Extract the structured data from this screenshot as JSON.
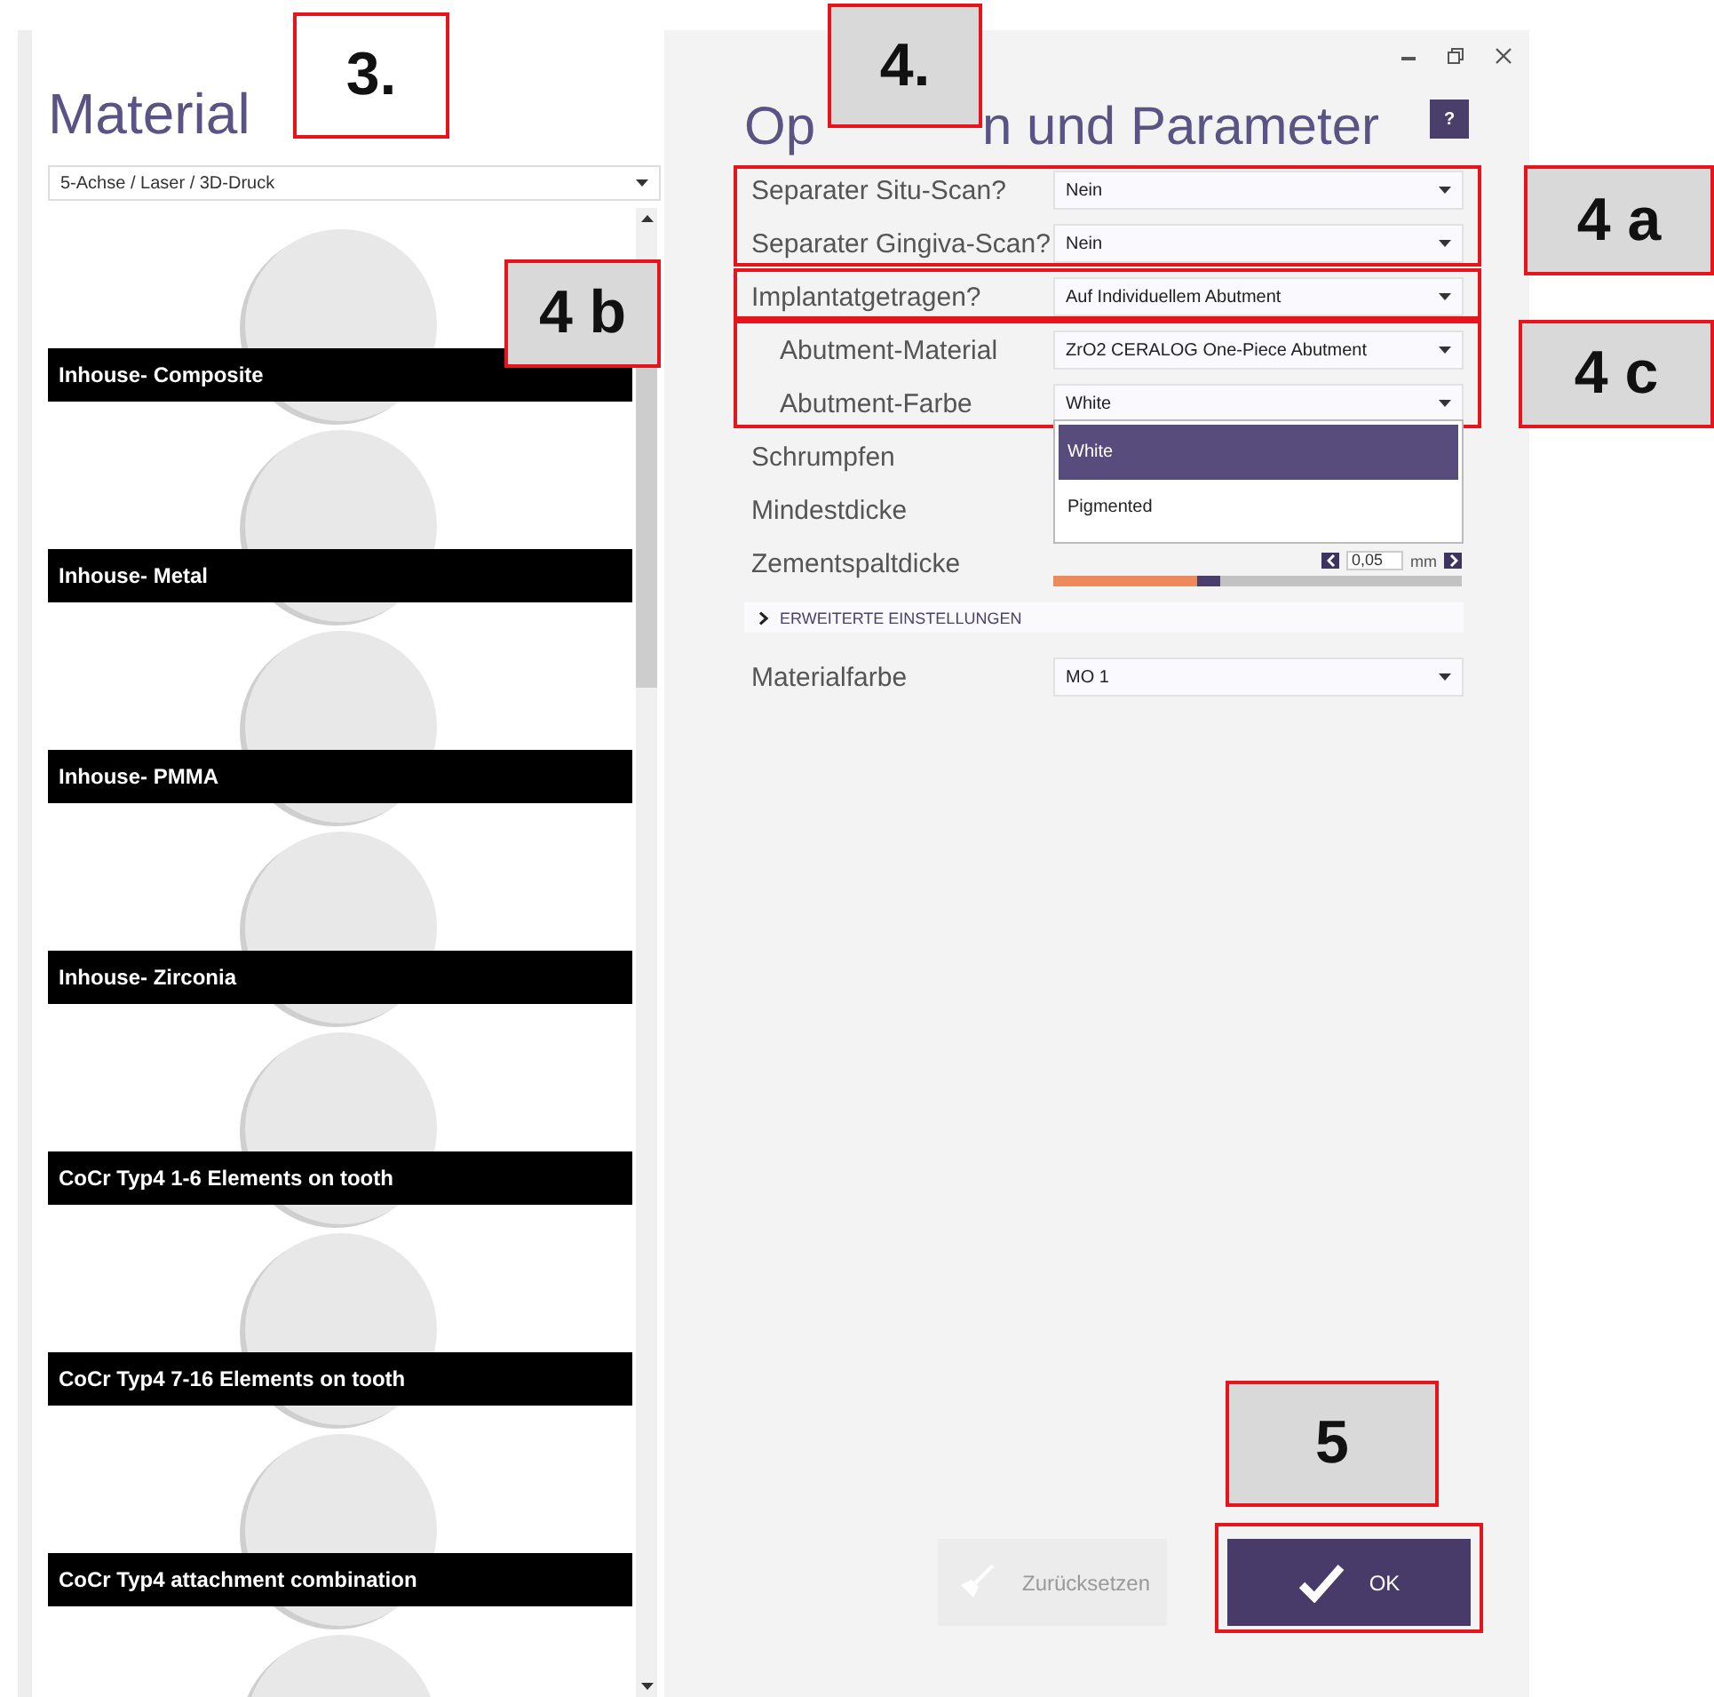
{
  "material_panel": {
    "title": "Material",
    "filter": "5-Achse / Laser / 3D-Druck",
    "materials": [
      {
        "name": "Inhouse- Composite"
      },
      {
        "name": "Inhouse- Metal"
      },
      {
        "name": "Inhouse- PMMA"
      },
      {
        "name": "Inhouse- Zirconia"
      },
      {
        "name": "CoCr Typ4 1-6 Elements on tooth"
      },
      {
        "name": "CoCr Typ4 7-16 Elements on tooth"
      },
      {
        "name": "CoCr Typ4 attachment combination"
      }
    ]
  },
  "options_panel": {
    "title_parts": [
      "Op",
      "n und Parameter"
    ],
    "help": "?",
    "fields": [
      {
        "label": "Separater Situ-Scan?",
        "value": "Nein",
        "indented": false
      },
      {
        "label": "Separater Gingiva-Scan?",
        "value": "Nein",
        "indented": false
      },
      {
        "label": "Implantatgetragen?",
        "value": "Auf Individuellem Abutment",
        "indented": false
      },
      {
        "label": "Abutment-Material",
        "value": "ZrO2 CERALOG One-Piece Abutment",
        "indented": true
      },
      {
        "label": "Abutment-Farbe",
        "value": "White",
        "indented": true
      }
    ],
    "open_dropdown": [
      {
        "label": "White",
        "selected": true
      },
      {
        "label": "Pigmented",
        "selected": false
      }
    ],
    "params": [
      {
        "label": "Schrumpfen"
      },
      {
        "label": "Mindestdicke"
      }
    ],
    "cement_gap": {
      "label": "Zementspaltdicke",
      "value": "0,05",
      "unit": "mm",
      "level": 0.35
    },
    "advanced": {
      "label": "ERWEITERTE EINSTELLUNGEN",
      "expanded": false
    },
    "material_color": {
      "label": "Materialfarbe",
      "value": "MO 1"
    },
    "buttons": [
      {
        "label": "Zurücksetzen",
        "disabled": true
      },
      {
        "label": "OK",
        "disabled": false
      }
    ]
  },
  "callouts": [
    {
      "label": "3."
    },
    {
      "label": "4."
    },
    {
      "label": "4 a"
    },
    {
      "label": "4 b"
    },
    {
      "label": "4 c"
    },
    {
      "label": "5"
    }
  ]
}
